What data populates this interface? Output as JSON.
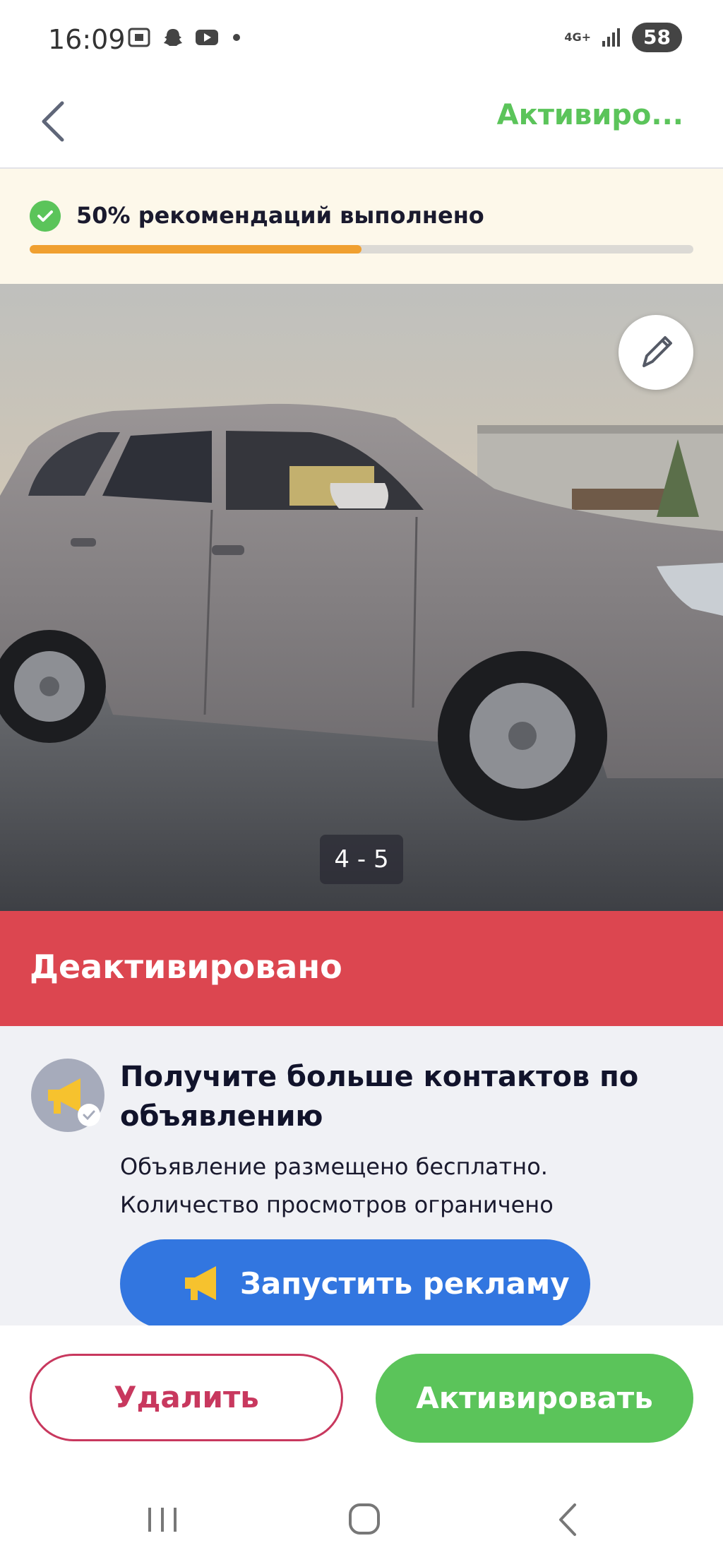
{
  "status_bar": {
    "time": "16:09",
    "network": "4G+",
    "battery": "58"
  },
  "header": {
    "action_label": "Активиро..."
  },
  "recommendations": {
    "text": "50% рекомендаций выполнено",
    "progress": 0.5
  },
  "photo": {
    "counter": "4 - 5"
  },
  "status_banner": {
    "label": "Деактивировано"
  },
  "promo": {
    "title": "Получите больше контактов по объявлению",
    "description": "Объявление размещено бесплатно. Количество просмотров ограничено",
    "button_label": "Запустить рекламу"
  },
  "actions": {
    "delete_label": "Удалить",
    "activate_label": "Активировать"
  },
  "colors": {
    "accent_green": "#5bc45a",
    "danger_red": "#dc4650",
    "promo_blue": "#3276e0",
    "progress_orange": "#f0a030"
  }
}
